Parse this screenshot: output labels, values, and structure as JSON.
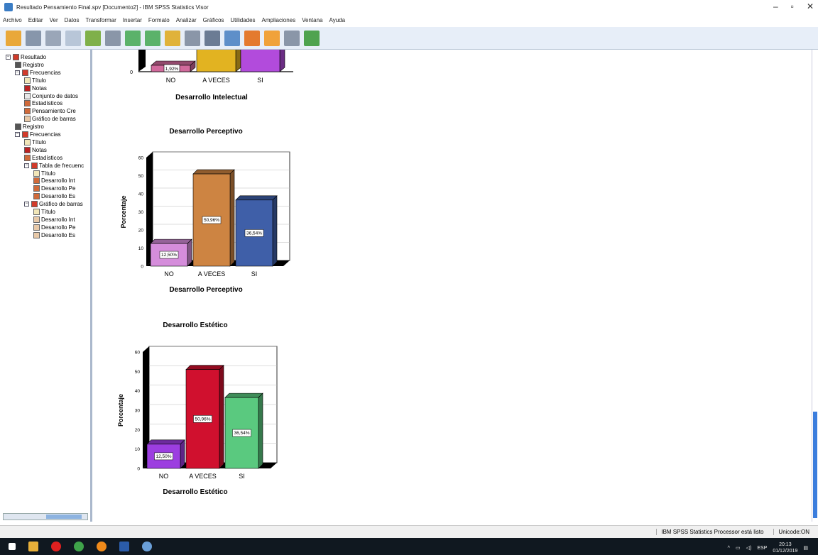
{
  "window": {
    "title": "Resultado Pensamiento Final.spv [Documento2] - IBM SPSS Statistics Visor",
    "minimize": "–",
    "maximize": "▫",
    "close": "✕"
  },
  "menu": [
    "Archivo",
    "Editar",
    "Ver",
    "Datos",
    "Transformar",
    "Insertar",
    "Formato",
    "Analizar",
    "Gráficos",
    "Utilidades",
    "Ampliaciones",
    "Ventana",
    "Ayuda"
  ],
  "tree": [
    {
      "label": "Resultado",
      "level": 0,
      "icon": "output-icon"
    },
    {
      "label": "Registro",
      "level": 1,
      "icon": "log-icon"
    },
    {
      "label": "Frecuencias",
      "level": 1,
      "icon": "procedure-icon"
    },
    {
      "label": "Título",
      "level": 2,
      "icon": "title-icon"
    },
    {
      "label": "Notas",
      "level": 2,
      "icon": "notes-icon"
    },
    {
      "label": "Conjunto de datos",
      "level": 2,
      "icon": "dataset-icon"
    },
    {
      "label": "Estadísticos",
      "level": 2,
      "icon": "table-icon"
    },
    {
      "label": "Pensamiento Cre",
      "level": 2,
      "icon": "table-icon"
    },
    {
      "label": "Gráfico de barras",
      "level": 2,
      "icon": "chart-icon"
    },
    {
      "label": "Registro",
      "level": 1,
      "icon": "log-icon"
    },
    {
      "label": "Frecuencias",
      "level": 1,
      "icon": "procedure-icon"
    },
    {
      "label": "Título",
      "level": 2,
      "icon": "title-icon"
    },
    {
      "label": "Notas",
      "level": 2,
      "icon": "notes-icon"
    },
    {
      "label": "Estadísticos",
      "level": 2,
      "icon": "table-icon"
    },
    {
      "label": "Tabla de frecuenc",
      "level": 2,
      "icon": "procedure-icon"
    },
    {
      "label": "Título",
      "level": 3,
      "icon": "title-icon"
    },
    {
      "label": "Desarrollo Int",
      "level": 3,
      "icon": "table-icon"
    },
    {
      "label": "Desarrollo Pe",
      "level": 3,
      "icon": "table-icon"
    },
    {
      "label": "Desarrollo Es",
      "level": 3,
      "icon": "table-icon"
    },
    {
      "label": "Gráfico de barras",
      "level": 2,
      "icon": "procedure-icon"
    },
    {
      "label": "Título",
      "level": 3,
      "icon": "title-icon"
    },
    {
      "label": "Desarrollo Int",
      "level": 3,
      "icon": "chart-icon"
    },
    {
      "label": "Desarrollo Pe",
      "level": 3,
      "icon": "chart-icon"
    },
    {
      "label": "Desarrollo Es",
      "level": 3,
      "icon": "chart-icon"
    }
  ],
  "status": {
    "processor": "IBM SPSS Statistics Processor está listo",
    "unicode": "Unicode:ON"
  },
  "taskbar": {
    "lang": "ESP",
    "time": "20:13",
    "date": "01/12/2019"
  },
  "chart_data": [
    {
      "type": "bar",
      "title": "",
      "xlabel": "Desarrollo Intelectual",
      "ylabel": "",
      "categories": [
        "NO",
        "A VECES",
        "SI"
      ],
      "values": [
        1.92,
        50,
        48
      ],
      "labels": [
        "1,92%",
        "",
        ""
      ],
      "colors": [
        "#d26a9c",
        "#e2b321",
        "#b24bdc"
      ],
      "partial": true
    },
    {
      "type": "bar",
      "title": "Desarrollo Perceptivo",
      "xlabel": "Desarrollo Perceptivo",
      "ylabel": "Porcentaje",
      "categories": [
        "NO",
        "A VECES",
        "SI"
      ],
      "values": [
        12.5,
        50.96,
        36.54
      ],
      "labels": [
        "12,50%",
        "50,96%",
        "36,54%"
      ],
      "colors": [
        "#d58ddb",
        "#cd8442",
        "#3f5fa8"
      ],
      "yticks": [
        0,
        10,
        20,
        30,
        40,
        50,
        60
      ],
      "ylim": [
        0,
        60
      ]
    },
    {
      "type": "bar",
      "title": "Desarrollo Estético",
      "xlabel": "Desarrollo Estético",
      "ylabel": "Porcentaje",
      "categories": [
        "NO",
        "A VECES",
        "SI"
      ],
      "values": [
        12.5,
        50.96,
        36.54
      ],
      "labels": [
        "12,50%",
        "50,96%",
        "36,54%"
      ],
      "colors": [
        "#9c3ee0",
        "#d0102e",
        "#5ac97f"
      ],
      "yticks": [
        0,
        10,
        20,
        30,
        40,
        50,
        60
      ],
      "ylim": [
        0,
        60
      ]
    }
  ]
}
